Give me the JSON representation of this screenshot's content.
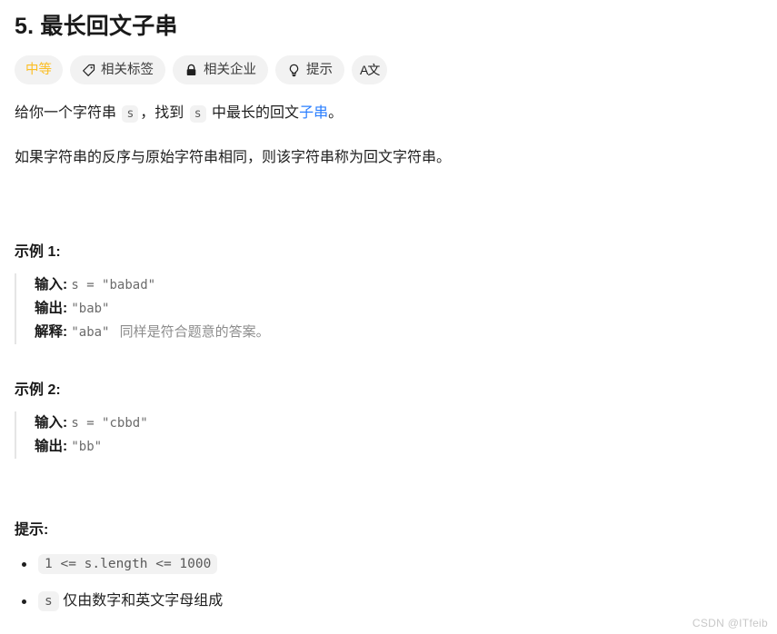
{
  "problem": {
    "title": "5. 最长回文子串",
    "badges": [
      {
        "label": "中等",
        "icon": "difficulty-text",
        "style": "difficulty"
      },
      {
        "label": "相关标签",
        "icon": "tag-icon",
        "style": "normal"
      },
      {
        "label": "相关企业",
        "icon": "lock-icon",
        "style": "normal"
      },
      {
        "label": "提示",
        "icon": "lightbulb-icon",
        "style": "normal"
      },
      {
        "label": "A文",
        "icon": "translate-icon",
        "style": "square"
      }
    ],
    "description": {
      "p1_part1": "给你一个字符串",
      "p1_code1": "s",
      "p1_part2": "，找到",
      "p1_code2": "s",
      "p1_part3": "中最长的回文",
      "p1_link": "子串",
      "p1_part4": "。",
      "p2": "如果字符串的反序与原始字符串相同，则该字符串称为回文字符串。"
    },
    "examples": [
      {
        "heading": "示例 1:",
        "lines": [
          {
            "label": "输入:",
            "code": "s = \"babad\"",
            "note": ""
          },
          {
            "label": "输出:",
            "code": "\"bab\"",
            "note": ""
          },
          {
            "label": "解释:",
            "code": "\"aba\"",
            "note": "同样是符合题意的答案。"
          }
        ]
      },
      {
        "heading": "示例 2:",
        "lines": [
          {
            "label": "输入:",
            "code": "s = \"cbbd\"",
            "note": ""
          },
          {
            "label": "输出:",
            "code": "\"bb\"",
            "note": ""
          }
        ]
      }
    ],
    "constraints": {
      "heading": "提示:",
      "items": [
        {
          "code": "1 <= s.length <= 1000",
          "text": ""
        },
        {
          "code": "s",
          "text": "仅由数字和英文字母组成"
        }
      ]
    }
  },
  "watermark": "CSDN @ITfeib",
  "colors": {
    "difficulty": "#fbbe24",
    "link": "#2b7fff",
    "chip_bg": "#f2f2f2",
    "badge_bg": "#f2f2f2",
    "text": "#1f1f1f"
  }
}
